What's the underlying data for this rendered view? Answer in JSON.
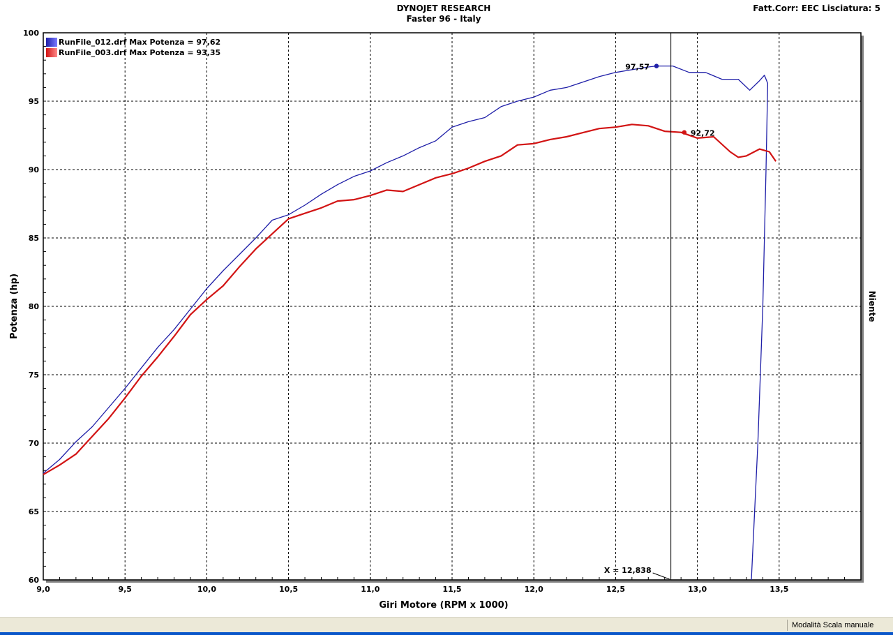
{
  "header": {
    "title": "DYNOJET RESEARCH",
    "subtitle": "Faster 96 - Italy",
    "correction_label": "Fatt.Corr: EEC  Lisciatura: 5"
  },
  "right_axis_label": "Niente",
  "status_bar": {
    "mode": "Modalità Scala manuale"
  },
  "colors": {
    "grid_bg": "#ffffff",
    "frame": "#000000",
    "series_blue": "#1f1fa8",
    "series_red": "#d21414"
  },
  "chart_data": {
    "type": "line",
    "xlabel": "Giri Motore (RPM x 1000)",
    "ylabel": "Potenza (hp)",
    "xlim": [
      9.0,
      14.0
    ],
    "ylim": [
      60,
      100
    ],
    "x_ticks": [
      "9,0",
      "9,5",
      "10,0",
      "10,5",
      "11,0",
      "11,5",
      "12,0",
      "12,5",
      "13,0",
      "13,5"
    ],
    "y_ticks": [
      "60",
      "65",
      "70",
      "75",
      "80",
      "85",
      "90",
      "95",
      "100"
    ],
    "grid": true,
    "legend_position": "top-left",
    "series": [
      {
        "name": "RunFile_012.drf Max Potenza = 97,62",
        "color": "#1f1fa8",
        "points": [
          [
            9.0,
            67.8
          ],
          [
            9.1,
            68.8
          ],
          [
            9.2,
            70.1
          ],
          [
            9.3,
            71.2
          ],
          [
            9.4,
            72.6
          ],
          [
            9.5,
            74.0
          ],
          [
            9.6,
            75.5
          ],
          [
            9.7,
            77.0
          ],
          [
            9.8,
            78.3
          ],
          [
            9.9,
            79.8
          ],
          [
            10.0,
            81.3
          ],
          [
            10.1,
            82.6
          ],
          [
            10.2,
            83.8
          ],
          [
            10.3,
            85.0
          ],
          [
            10.4,
            86.3
          ],
          [
            10.5,
            86.7
          ],
          [
            10.6,
            87.4
          ],
          [
            10.7,
            88.2
          ],
          [
            10.8,
            88.9
          ],
          [
            10.9,
            89.5
          ],
          [
            11.0,
            89.9
          ],
          [
            11.1,
            90.5
          ],
          [
            11.2,
            91.0
          ],
          [
            11.3,
            91.6
          ],
          [
            11.4,
            92.1
          ],
          [
            11.5,
            93.1
          ],
          [
            11.6,
            93.5
          ],
          [
            11.7,
            93.8
          ],
          [
            11.8,
            94.6
          ],
          [
            11.9,
            95.0
          ],
          [
            12.0,
            95.3
          ],
          [
            12.1,
            95.8
          ],
          [
            12.2,
            96.0
          ],
          [
            12.3,
            96.4
          ],
          [
            12.4,
            96.8
          ],
          [
            12.5,
            97.1
          ],
          [
            12.6,
            97.3
          ],
          [
            12.7,
            97.5
          ],
          [
            12.75,
            97.57
          ],
          [
            12.85,
            97.57
          ],
          [
            12.95,
            97.1
          ],
          [
            13.05,
            97.1
          ],
          [
            13.15,
            96.6
          ],
          [
            13.25,
            96.6
          ],
          [
            13.32,
            95.8
          ],
          [
            13.38,
            96.5
          ],
          [
            13.41,
            96.9
          ],
          [
            13.43,
            96.3
          ],
          [
            13.42,
            90.0
          ],
          [
            13.4,
            80.0
          ],
          [
            13.37,
            70.0
          ],
          [
            13.33,
            60.0
          ]
        ]
      },
      {
        "name": "RunFile_003.drf Max Potenza = 93,35",
        "color": "#d21414",
        "points": [
          [
            9.0,
            67.7
          ],
          [
            9.1,
            68.4
          ],
          [
            9.2,
            69.2
          ],
          [
            9.3,
            70.5
          ],
          [
            9.4,
            71.8
          ],
          [
            9.5,
            73.3
          ],
          [
            9.6,
            74.9
          ],
          [
            9.7,
            76.3
          ],
          [
            9.8,
            77.8
          ],
          [
            9.9,
            79.4
          ],
          [
            10.0,
            80.5
          ],
          [
            10.1,
            81.5
          ],
          [
            10.2,
            82.9
          ],
          [
            10.3,
            84.2
          ],
          [
            10.4,
            85.3
          ],
          [
            10.5,
            86.4
          ],
          [
            10.6,
            86.8
          ],
          [
            10.7,
            87.2
          ],
          [
            10.8,
            87.7
          ],
          [
            10.9,
            87.8
          ],
          [
            11.0,
            88.1
          ],
          [
            11.1,
            88.5
          ],
          [
            11.2,
            88.4
          ],
          [
            11.3,
            88.9
          ],
          [
            11.4,
            89.4
          ],
          [
            11.5,
            89.7
          ],
          [
            11.6,
            90.1
          ],
          [
            11.7,
            90.6
          ],
          [
            11.8,
            91.0
          ],
          [
            11.9,
            91.8
          ],
          [
            12.0,
            91.9
          ],
          [
            12.1,
            92.2
          ],
          [
            12.2,
            92.4
          ],
          [
            12.3,
            92.7
          ],
          [
            12.4,
            93.0
          ],
          [
            12.5,
            93.1
          ],
          [
            12.6,
            93.3
          ],
          [
            12.7,
            93.2
          ],
          [
            12.8,
            92.8
          ],
          [
            12.9,
            92.72
          ],
          [
            13.0,
            92.3
          ],
          [
            13.1,
            92.4
          ],
          [
            13.2,
            91.3
          ],
          [
            13.25,
            90.9
          ],
          [
            13.3,
            91.0
          ],
          [
            13.38,
            91.5
          ],
          [
            13.44,
            91.3
          ],
          [
            13.48,
            90.6
          ]
        ]
      }
    ],
    "markers": [
      {
        "series": 0,
        "x": 12.75,
        "y": 97.57,
        "label": "97,57",
        "label_side": "left"
      },
      {
        "series": 1,
        "x": 12.92,
        "y": 92.72,
        "label": "92,72",
        "label_side": "right"
      }
    ],
    "cursor": {
      "x": 12.838,
      "label": "X = 12,838"
    }
  }
}
